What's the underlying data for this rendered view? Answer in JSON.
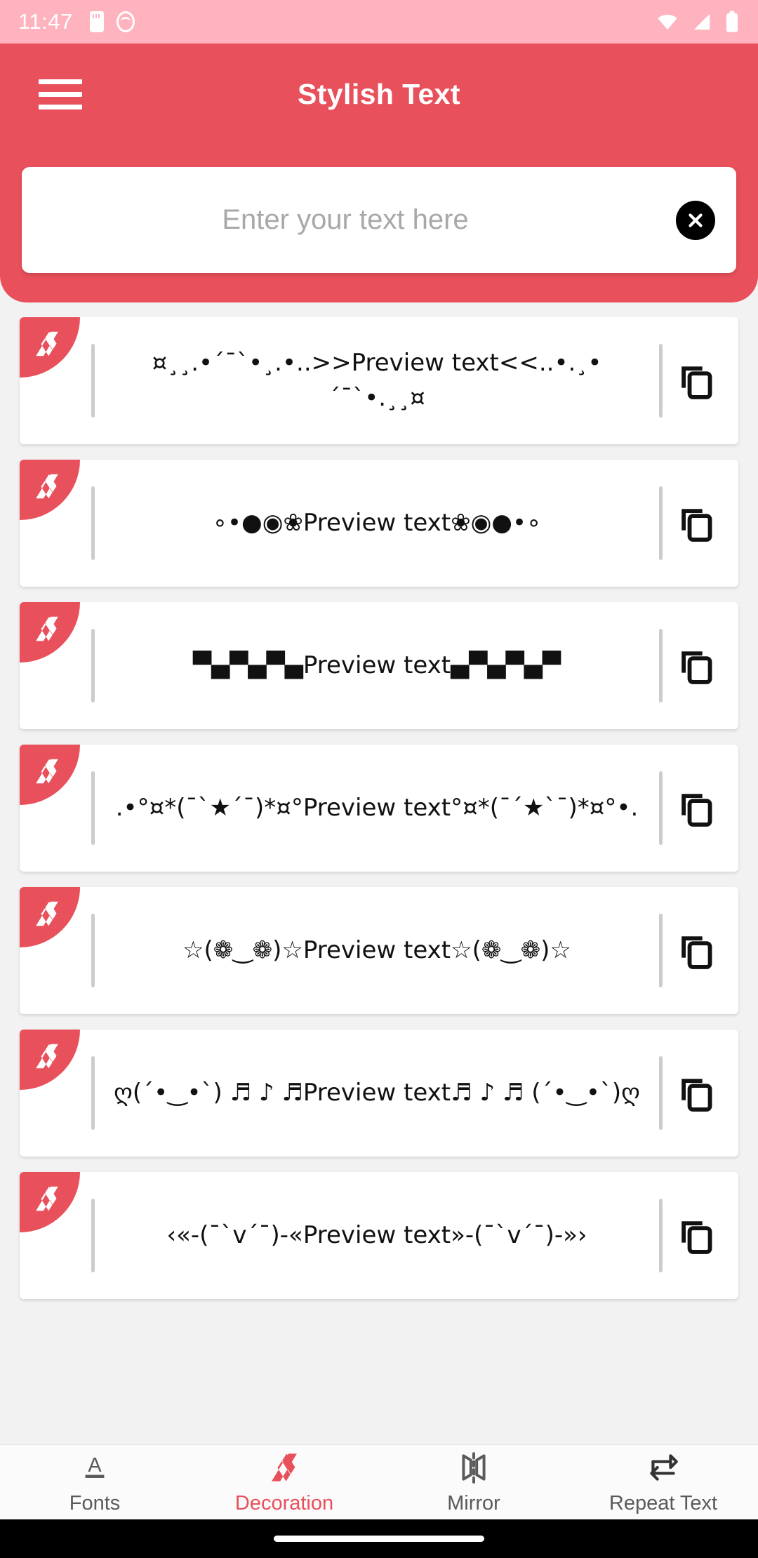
{
  "status_bar": {
    "time": "11:47",
    "icons": [
      "sd-card-icon",
      "cat-face-icon",
      "wifi-icon",
      "signal-icon",
      "battery-icon"
    ]
  },
  "app_bar": {
    "title": "Stylish Text",
    "menu_icon": "hamburger-menu-icon",
    "background": "#e8505b"
  },
  "search": {
    "placeholder": "Enter your text here",
    "value": "",
    "clear_icon": "close-circle-icon"
  },
  "list": {
    "badge_icon": "stylish-text-logo-icon",
    "copy_icon": "copy-icon",
    "items": [
      {
        "text": "¤¸¸.•´¯`•¸.•..>>Preview text<<..•.¸•´¯`•.¸¸¤"
      },
      {
        "text": "∘•●◉❀Preview text❀◉●•∘"
      },
      {
        "text": "▀▄▀▄▀▄Preview text▄▀▄▀▄▀"
      },
      {
        "text": ".•°¤*(¯`★´¯)*¤°Preview text°¤*(¯´★`¯)*¤°•."
      },
      {
        "text": "☆(❁‿❁)☆Preview text☆(❁‿❁)☆"
      },
      {
        "text": "ღ(´•‿•`) ♬ ♪ ♬Preview text♬ ♪ ♬ (´•‿•`)ღ"
      },
      {
        "text": "‹«-(¯`v´¯)-«Preview text»-(¯`v´¯)-»›"
      }
    ]
  },
  "bottom_nav": {
    "active_color": "#e8505b",
    "items": [
      {
        "label": "Fonts",
        "icon": "font-a-icon",
        "active": false
      },
      {
        "label": "Decoration",
        "icon": "decoration-icon",
        "active": true
      },
      {
        "label": "Mirror",
        "icon": "mirror-icon",
        "active": false
      },
      {
        "label": "Repeat Text",
        "icon": "repeat-icon",
        "active": false
      }
    ]
  }
}
